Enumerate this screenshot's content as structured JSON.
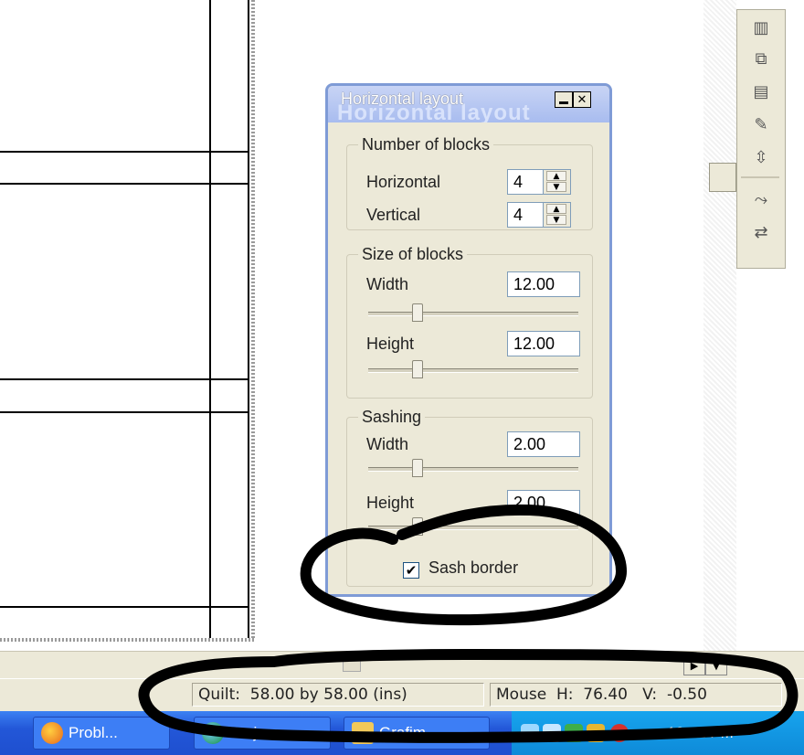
{
  "dialog": {
    "title": "Horizontal layout",
    "title_ghost": "Horizontal layout",
    "number_of_blocks": {
      "legend": "Number of blocks",
      "horizontal_label": "Horizontal",
      "horizontal_value": "4",
      "vertical_label": "Vertical",
      "vertical_value": "4"
    },
    "size_of_blocks": {
      "legend": "Size of blocks",
      "width_label": "Width",
      "width_value": "12.00",
      "width_slider_level": 0.22,
      "height_label": "Height",
      "height_value": "12.00",
      "height_slider_level": 0.22
    },
    "sashing": {
      "legend": "Sashing",
      "width_label": "Width",
      "width_value": "2.00",
      "width_slider_level": 0.22,
      "height_label": "Height",
      "height_value": "2.00",
      "height_slider_level": 0.22
    },
    "sash_border_label": "Sash border",
    "sash_border_checked": true
  },
  "statusbar": {
    "quilt": "Quilt:  58.00 by 58.00 (ins)",
    "mouse": "Mouse  H:  76.40   V:  -0.50"
  },
  "taskbar": {
    "items": [
      {
        "label": "Probl...",
        "icon": "firefox-icon"
      },
      {
        "label": "Projem",
        "icon": "ie-icon"
      },
      {
        "label": "Grafim",
        "icon": "folder-icon"
      }
    ],
    "clock": "10:02 PM"
  },
  "toolbar": {
    "icons": [
      "spool-icon",
      "swap-blocks-icon",
      "thread-icon",
      "eyedropper-icon",
      "arrange-icon",
      "rotate-icon",
      "refresh-icon"
    ]
  },
  "colors": {
    "taskbar": "#2357d8",
    "dialog_border": "#7f9bd6",
    "panel": "#ece9d8",
    "annotation": "#000000"
  }
}
